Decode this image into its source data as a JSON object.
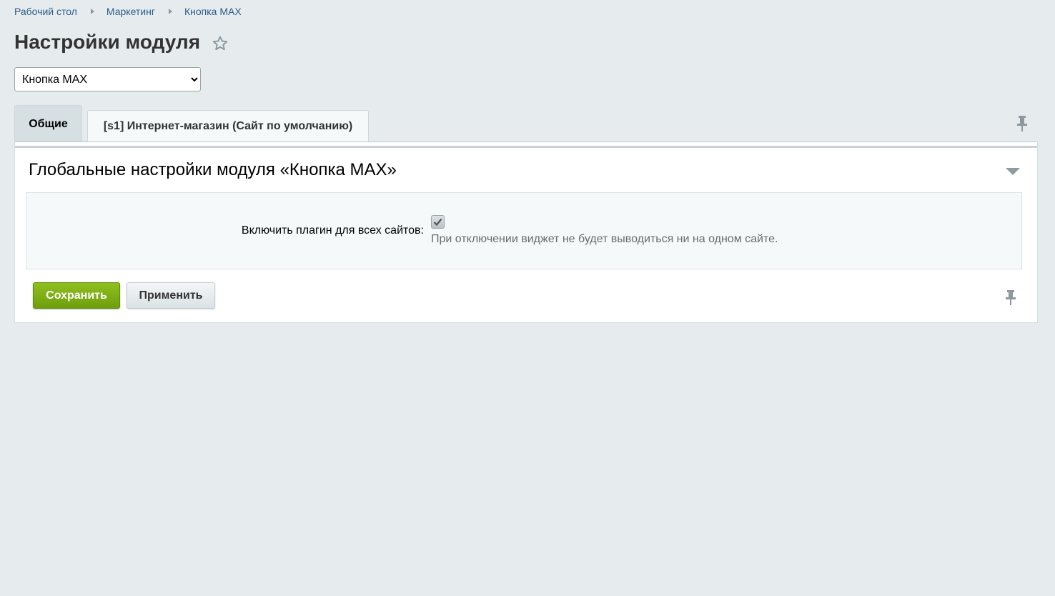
{
  "breadcrumb": {
    "items": [
      "Рабочий стол",
      "Маркетинг",
      "Кнопка MAX"
    ]
  },
  "page": {
    "title": "Настройки модуля"
  },
  "module_select": {
    "selected": "Кнопка MAX"
  },
  "tabs": [
    {
      "label": "Общие",
      "active": true
    },
    {
      "label": "[s1] Интернет-магазин (Сайт по умолчанию)",
      "active": false
    }
  ],
  "section": {
    "title": "Глобальные настройки модуля «Кнопка MAX»"
  },
  "settings": {
    "enable_label": "Включить плагин для всех сайтов:",
    "enable_checked": true,
    "enable_hint": "При отключении виджет не будет выводиться ни на одном сайте."
  },
  "buttons": {
    "save_label": "Сохранить",
    "apply_label": "Применить"
  },
  "icons": {
    "star": "star-icon",
    "pin": "pin-icon",
    "collapse": "triangle-down-icon",
    "check": "check-icon"
  },
  "colors": {
    "background": "#e6ecee",
    "link": "#2d5c88",
    "save_button": "#7cae14"
  }
}
